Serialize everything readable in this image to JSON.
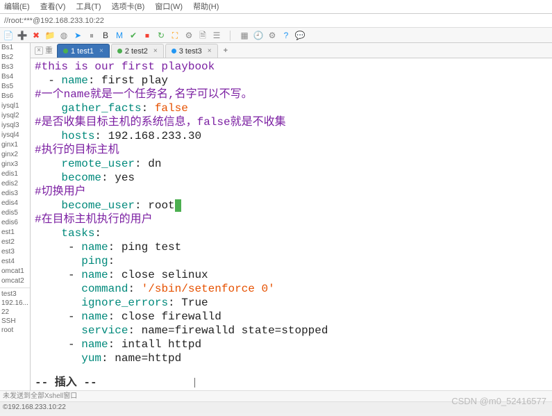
{
  "menu": {
    "items": [
      "编辑(E)",
      "查看(V)",
      "工具(T)",
      "选项卡(B)",
      "窗口(W)",
      "帮助(H)"
    ]
  },
  "address": "//root:***@192.168.233.10:22",
  "toolbar_icons": [
    {
      "name": "file-icon",
      "glyph": "📄",
      "color": "#666"
    },
    {
      "name": "add-icon",
      "glyph": "➕",
      "color": "#4caf50"
    },
    {
      "name": "cross-icon",
      "glyph": "✖",
      "color": "#f44336"
    },
    {
      "name": "folder-icon",
      "glyph": "📁",
      "color": "#ff9800"
    },
    {
      "name": "disk-icon",
      "glyph": "◍",
      "color": "#888"
    },
    {
      "name": "arrow-icon",
      "glyph": "➤",
      "color": "#2196f3"
    },
    {
      "name": "pause-icon",
      "glyph": "⏸",
      "color": "#888"
    },
    {
      "name": "bold-icon",
      "glyph": "B",
      "color": "#333"
    },
    {
      "name": "italic-icon",
      "glyph": "M",
      "color": "#2196f3"
    },
    {
      "name": "check-icon",
      "glyph": "✔",
      "color": "#4caf50"
    },
    {
      "name": "stop-icon",
      "glyph": "⏹",
      "color": "#f44336"
    },
    {
      "name": "refresh-icon",
      "glyph": "↻",
      "color": "#4caf50"
    },
    {
      "name": "full-icon",
      "glyph": "⛶",
      "color": "#ff9800"
    },
    {
      "name": "gear-icon",
      "glyph": "⚙",
      "color": "#888"
    },
    {
      "name": "layers-icon",
      "glyph": "🗎",
      "color": "#888"
    },
    {
      "name": "list-icon",
      "glyph": "☰",
      "color": "#888"
    },
    {
      "name": "sep",
      "glyph": "│",
      "color": "#ccc"
    },
    {
      "name": "grid-icon",
      "glyph": "▦",
      "color": "#888"
    },
    {
      "name": "clock-icon",
      "glyph": "🕘",
      "color": "#888"
    },
    {
      "name": "gear2-icon",
      "glyph": "⚙",
      "color": "#888"
    },
    {
      "name": "help-icon",
      "glyph": "?",
      "color": "#2196f3"
    },
    {
      "name": "chat-icon",
      "glyph": "💬",
      "color": "#888"
    }
  ],
  "side_tab": "重",
  "tabs": [
    {
      "label": "1 test1",
      "active": true,
      "style": "green",
      "close": "×"
    },
    {
      "label": "2 test2",
      "active": false,
      "style": "green",
      "close": "×"
    },
    {
      "label": "3 test3",
      "active": false,
      "style": "blue",
      "close": "×"
    }
  ],
  "tab_add": "+",
  "sidebar": {
    "groups": [
      "Bs1",
      "Bs2",
      "Bs3",
      "Bs4",
      "Bs5",
      "Bs6",
      "iysql1",
      "iysql2",
      "iysql3",
      "iysql4",
      "ginx1",
      "ginx2",
      "ginx3",
      "edis1",
      "edis2",
      "edis3",
      "edis4",
      "edis5",
      "edis6",
      "est1",
      "est2",
      "est3",
      "est4",
      "omcat1",
      "omcat2"
    ],
    "info": [
      "test3",
      "192.16...",
      "22",
      "SSH",
      "root"
    ]
  },
  "term": {
    "lines": [
      {
        "segs": [
          {
            "t": "#this is our first playbook",
            "c": "c-purple"
          }
        ]
      },
      {
        "segs": [
          {
            "t": "  - ",
            "c": ""
          },
          {
            "t": "name",
            "c": "c-teal"
          },
          {
            "t": ": first play",
            "c": ""
          }
        ]
      },
      {
        "segs": [
          {
            "t": "#一个name就是一个任务名,名字可以不写。",
            "c": "c-purple"
          }
        ]
      },
      {
        "segs": [
          {
            "t": "    ",
            "c": ""
          },
          {
            "t": "gather_facts",
            "c": "c-teal"
          },
          {
            "t": ": ",
            "c": ""
          },
          {
            "t": "false",
            "c": "c-orange"
          }
        ]
      },
      {
        "segs": [
          {
            "t": "#是否收集目标主机的系统信息，false就是不收集",
            "c": "c-purple"
          }
        ]
      },
      {
        "segs": [
          {
            "t": "    ",
            "c": ""
          },
          {
            "t": "hosts",
            "c": "c-teal"
          },
          {
            "t": ": 192.168.233.30",
            "c": ""
          }
        ]
      },
      {
        "segs": [
          {
            "t": "#执行的目标主机",
            "c": "c-purple"
          }
        ]
      },
      {
        "segs": [
          {
            "t": "    ",
            "c": ""
          },
          {
            "t": "remote_user",
            "c": "c-teal"
          },
          {
            "t": ": dn",
            "c": ""
          }
        ]
      },
      {
        "segs": [
          {
            "t": "    ",
            "c": ""
          },
          {
            "t": "become",
            "c": "c-teal"
          },
          {
            "t": ": yes",
            "c": ""
          }
        ]
      },
      {
        "segs": [
          {
            "t": "#切换用户",
            "c": "c-purple"
          }
        ]
      },
      {
        "segs": [
          {
            "t": "    ",
            "c": ""
          },
          {
            "t": "become_user",
            "c": "c-teal"
          },
          {
            "t": ": root",
            "c": ""
          },
          {
            "t": " ",
            "c": "c-green-bg"
          }
        ]
      },
      {
        "segs": [
          {
            "t": "#在目标主机执行的用户",
            "c": "c-purple"
          }
        ]
      },
      {
        "segs": [
          {
            "t": "    ",
            "c": ""
          },
          {
            "t": "tasks",
            "c": "c-teal"
          },
          {
            "t": ":",
            "c": ""
          }
        ]
      },
      {
        "segs": [
          {
            "t": "     - ",
            "c": ""
          },
          {
            "t": "name",
            "c": "c-teal"
          },
          {
            "t": ": ping test",
            "c": ""
          }
        ]
      },
      {
        "segs": [
          {
            "t": "       ",
            "c": ""
          },
          {
            "t": "ping",
            "c": "c-teal"
          },
          {
            "t": ":",
            "c": ""
          }
        ]
      },
      {
        "segs": [
          {
            "t": "     - ",
            "c": ""
          },
          {
            "t": "name",
            "c": "c-teal"
          },
          {
            "t": ": close selinux",
            "c": ""
          }
        ]
      },
      {
        "segs": [
          {
            "t": "       ",
            "c": ""
          },
          {
            "t": "command",
            "c": "c-teal"
          },
          {
            "t": ": ",
            "c": ""
          },
          {
            "t": "'/sbin/setenforce 0'",
            "c": "c-orange"
          }
        ]
      },
      {
        "segs": [
          {
            "t": "       ",
            "c": ""
          },
          {
            "t": "ignore_errors",
            "c": "c-teal"
          },
          {
            "t": ": True",
            "c": ""
          }
        ]
      },
      {
        "segs": [
          {
            "t": "     - ",
            "c": ""
          },
          {
            "t": "name",
            "c": "c-teal"
          },
          {
            "t": ": close firewalld",
            "c": ""
          }
        ]
      },
      {
        "segs": [
          {
            "t": "       ",
            "c": ""
          },
          {
            "t": "service",
            "c": "c-teal"
          },
          {
            "t": ": name=firewalld state=stopped",
            "c": ""
          }
        ]
      },
      {
        "segs": [
          {
            "t": "     - ",
            "c": ""
          },
          {
            "t": "name",
            "c": "c-teal"
          },
          {
            "t": ": intall httpd",
            "c": ""
          }
        ]
      },
      {
        "segs": [
          {
            "t": "       ",
            "c": ""
          },
          {
            "t": "yum",
            "c": "c-teal"
          },
          {
            "t": ": name=httpd",
            "c": ""
          }
        ]
      }
    ],
    "status": "-- 插入 --"
  },
  "bottom1": "未发送到全部Xshell窗口",
  "bottom2": "©192.168.233.10:22",
  "watermark": "CSDN @m0_52416577"
}
